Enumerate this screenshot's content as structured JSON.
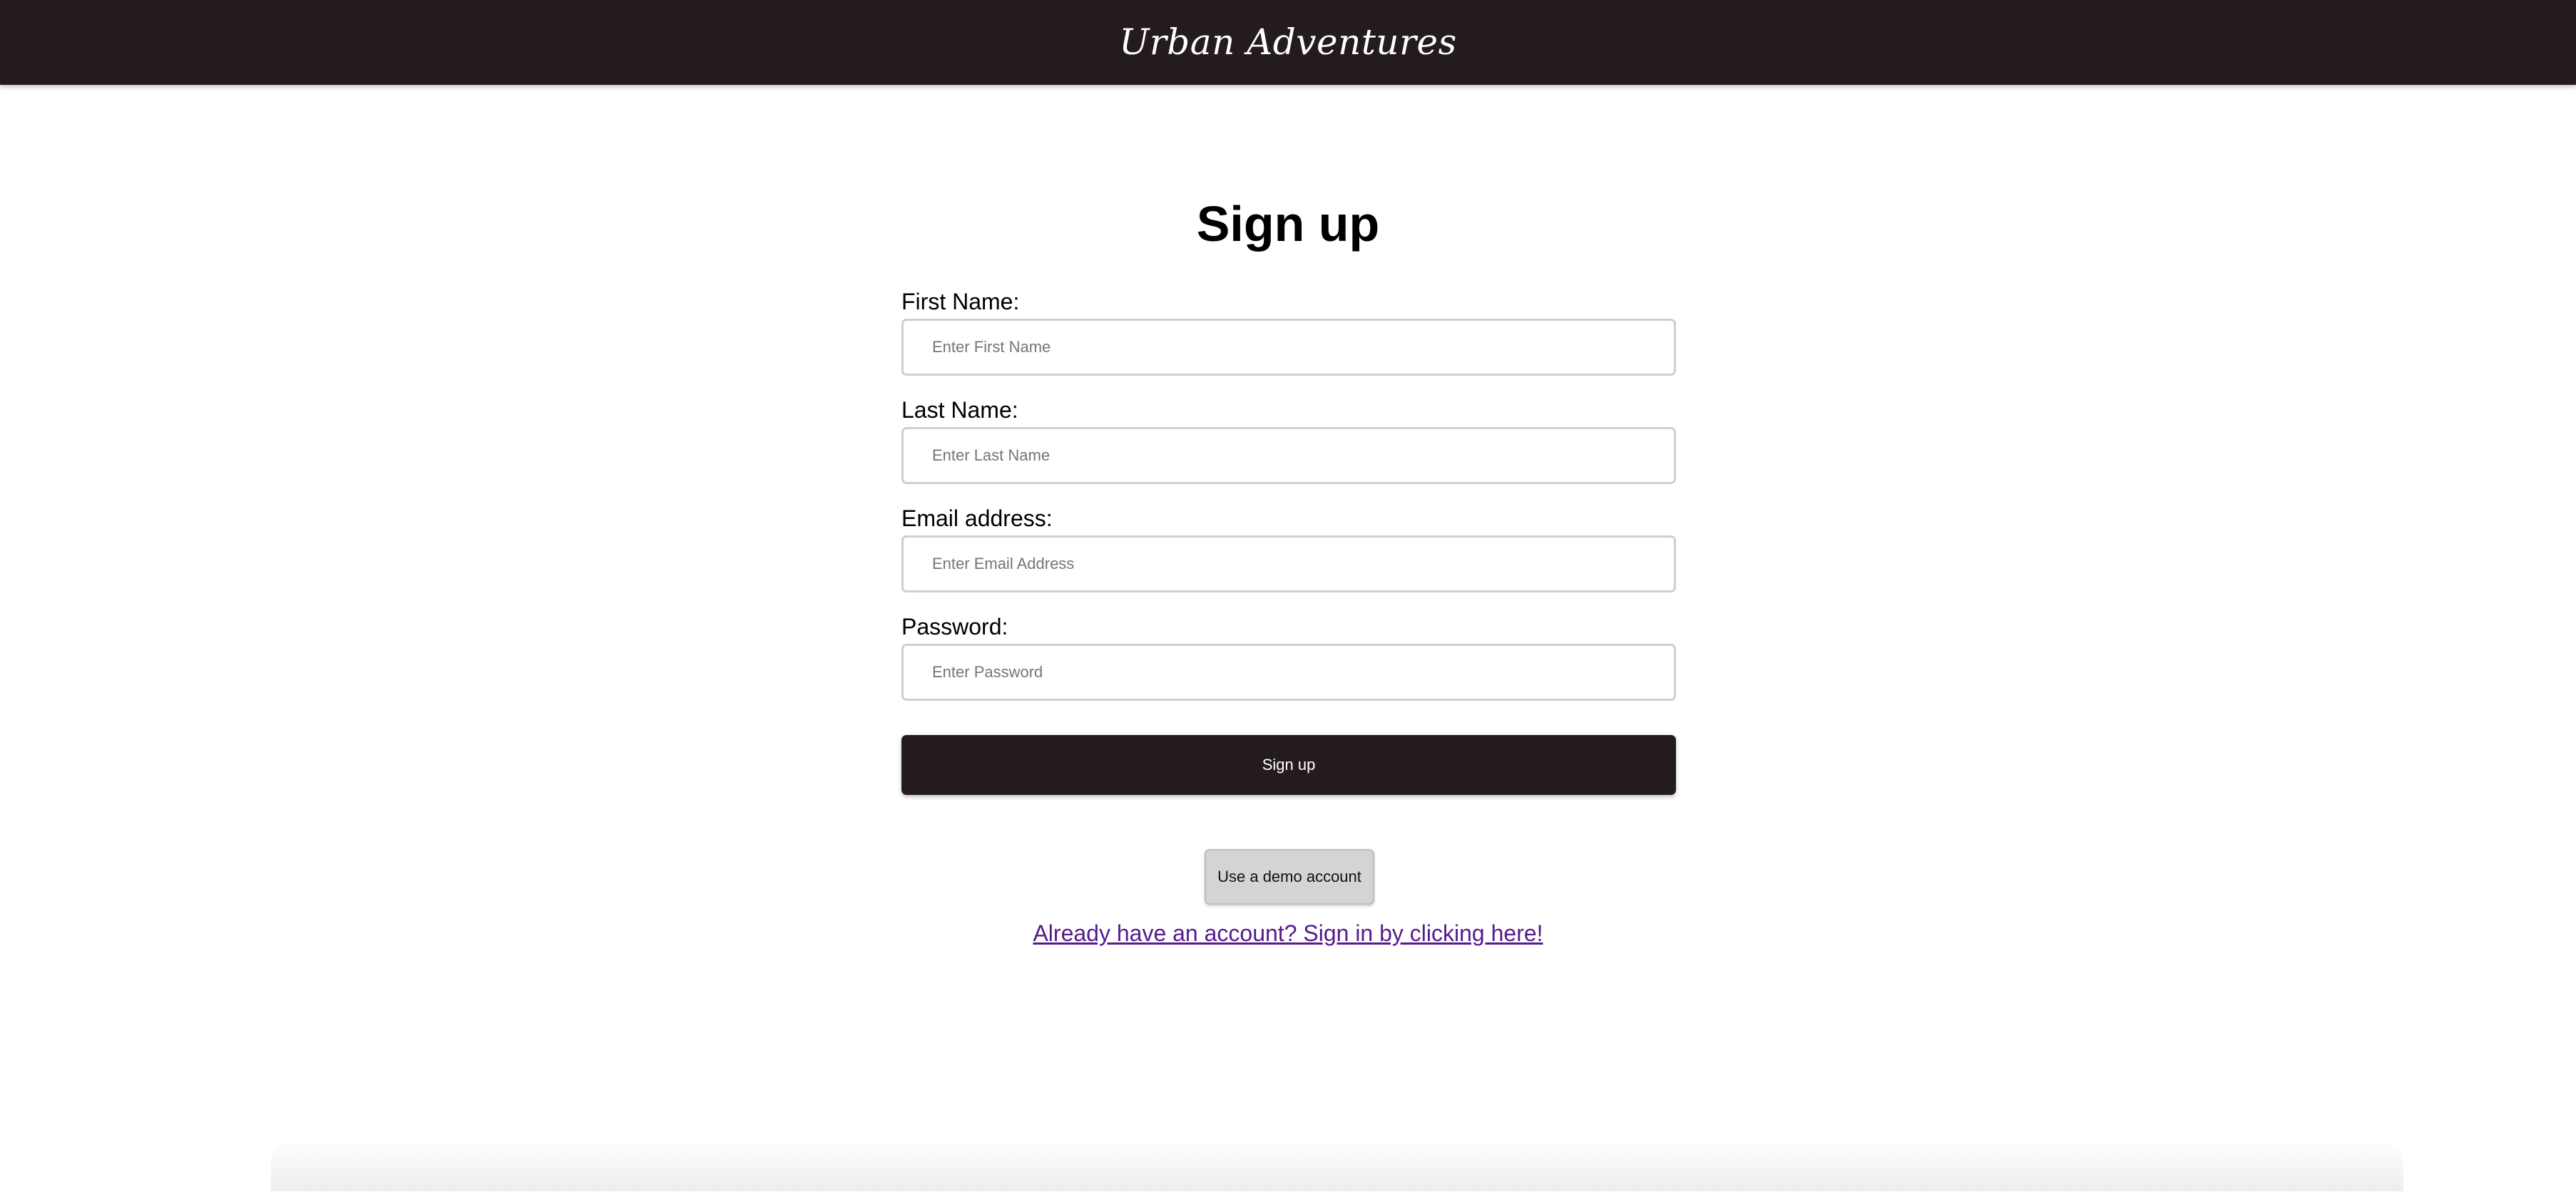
{
  "header": {
    "brand": "Urban Adventures"
  },
  "form": {
    "title": "Sign up",
    "fields": [
      {
        "label": "First Name:",
        "placeholder": "Enter First Name",
        "value": ""
      },
      {
        "label": "Last Name:",
        "placeholder": "Enter Last Name",
        "value": ""
      },
      {
        "label": "Email address:",
        "placeholder": "Enter Email Address",
        "value": ""
      },
      {
        "label": "Password:",
        "placeholder": "Enter Password",
        "value": ""
      }
    ],
    "submit_label": "Sign up"
  },
  "demo_button_label": "Use a demo account",
  "signin_link_text": "Already have an account? Sign in by clicking here!",
  "colors": {
    "header_bg": "#241b1e",
    "primary_button": "#241b1e",
    "link": "#551a8b",
    "secondary_button": "#d4d4d4"
  }
}
